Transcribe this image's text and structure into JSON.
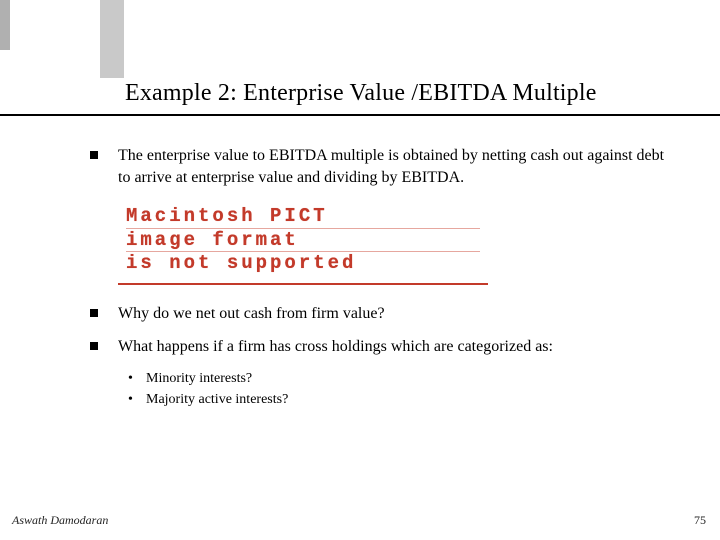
{
  "title": "Example 2: Enterprise Value /EBITDA Multiple",
  "bullets": {
    "b1": "The enterprise value to EBITDA multiple is obtained by netting cash out against debt to arrive at enterprise value and dividing by EBITDA.",
    "b2": "Why do we net out cash from firm value?",
    "b3": "What happens if a firm has cross holdings which are categorized as:",
    "sub1": "Minority interests?",
    "sub2": "Majority active interests?"
  },
  "placeholder": {
    "l1": "Macintosh PICT",
    "l2": "image format",
    "l3": "is not supported"
  },
  "footer": {
    "author": "Aswath Damodaran",
    "page": "75"
  }
}
